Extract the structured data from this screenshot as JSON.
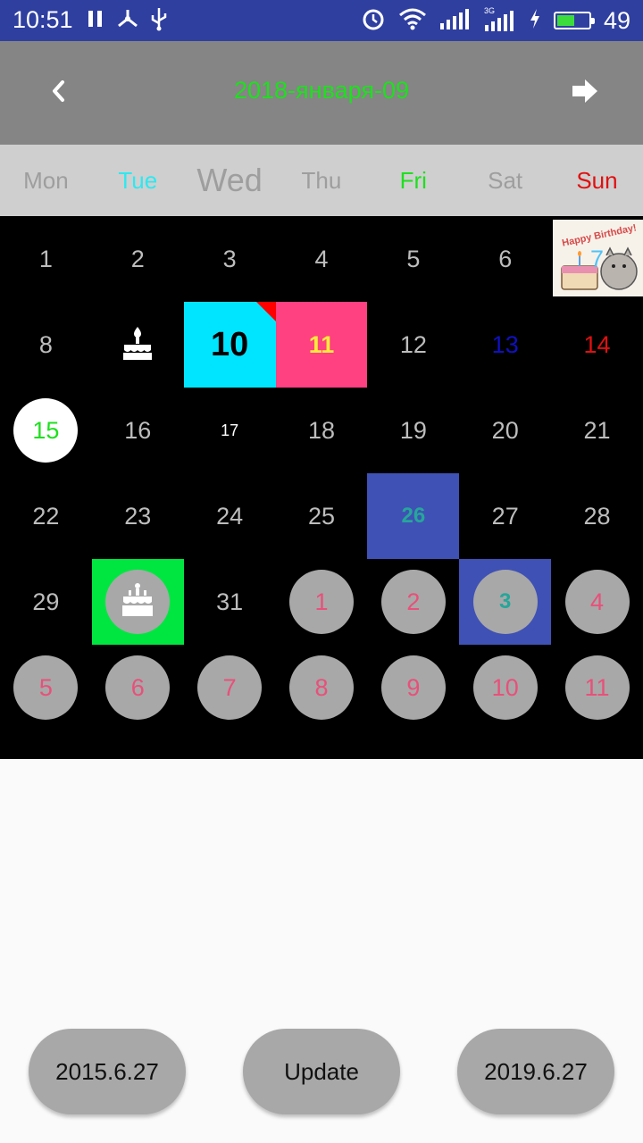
{
  "status_bar": {
    "time": "10:51",
    "battery": "49",
    "icons": [
      "pause-icon",
      "tether-icon",
      "usb-icon",
      "alarm-icon",
      "wifi-icon",
      "signal-icon",
      "3g-signal-icon",
      "charging-icon",
      "battery-icon"
    ]
  },
  "header": {
    "title": "2018-января-09",
    "title_color": "#1ee01e",
    "prev_icon": "chevron-left-icon",
    "next_icon": "arrow-right-icon"
  },
  "weekdays": [
    {
      "label": "Mon",
      "color": "#9e9e9e"
    },
    {
      "label": "Tue",
      "color": "#2ee8f0"
    },
    {
      "label": "Wed",
      "color": "#9e9e9e"
    },
    {
      "label": "Thu",
      "color": "#9e9e9e"
    },
    {
      "label": "Fri",
      "color": "#1ee01e"
    },
    {
      "label": "Sat",
      "color": "#9e9e9e"
    },
    {
      "label": "Sun",
      "color": "#e01010"
    }
  ],
  "days": {
    "d1": "1",
    "d2": "2",
    "d3": "3",
    "d4": "4",
    "d5": "5",
    "d6": "6",
    "d7": "7",
    "birthday_caption": "Happy Birthday!",
    "d8": "8",
    "d10": "10",
    "d11": "11",
    "d12": "12",
    "d13": "13",
    "d14": "14",
    "d15": "15",
    "d16": "16",
    "d17": "17",
    "d18": "18",
    "d19": "19",
    "d20": "20",
    "d21": "21",
    "d22": "22",
    "d23": "23",
    "d24": "24",
    "d25": "25",
    "d26": "26",
    "d27": "27",
    "d28": "28",
    "d29": "29",
    "d31": "31",
    "n1": "1",
    "n2": "2",
    "n3": "3",
    "n4": "4",
    "n5": "5",
    "n6": "6",
    "n7": "7",
    "n8": "8",
    "n9": "9",
    "n10": "10",
    "n11": "11"
  },
  "buttons": {
    "prev_date": "2015.6.27",
    "update": "Update",
    "next_date": "2019.6.27"
  }
}
